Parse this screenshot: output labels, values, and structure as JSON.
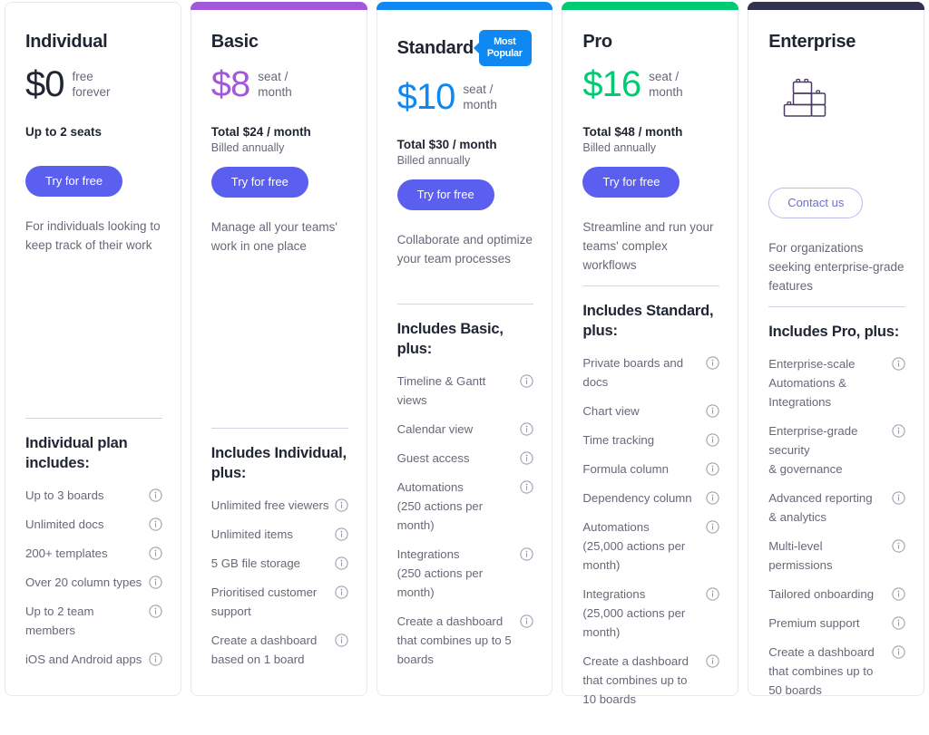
{
  "colors": {
    "individual_accent": "#1f2533",
    "basic_accent": "#a259d9",
    "standard_accent": "#0f88f2",
    "pro_accent": "#00ca72",
    "enterprise_accent": "#30324e",
    "cta_primary": "#5b5fef",
    "cta_outline_text": "#6b6fd4",
    "badge_bg": "#0f88f2",
    "body_text": "#676879",
    "heading_text": "#1f2533",
    "card_border": "#e6e9ef",
    "divider": "#d0d4e4"
  },
  "plans": [
    {
      "id": "individual",
      "name": "Individual",
      "top_bar_color": "",
      "has_top_bar": false,
      "price_amount": "$0",
      "price_unit": "free\nforever",
      "price_color": "#1f2533",
      "total_line": "",
      "billed_line": "",
      "seats_line": "Up to 2 seats",
      "cta_label": "Try for free",
      "cta_style": "primary",
      "tagline": "For individuals looking to keep track of their work",
      "features_title": "Individual plan includes:",
      "features": [
        "Up to 3 boards",
        "Unlimited docs",
        "200+ templates",
        "Over 20 column types",
        "Up to 2 team members",
        "iOS and Android apps"
      ]
    },
    {
      "id": "basic",
      "name": "Basic",
      "top_bar_color": "#a259d9",
      "has_top_bar": true,
      "price_amount": "$8",
      "price_unit": "seat /\nmonth",
      "price_color": "#a259d9",
      "total_line": "Total $24 / month",
      "billed_line": "Billed annually",
      "seats_line": "",
      "cta_label": "Try for free",
      "cta_style": "primary",
      "tagline": "Manage all your teams' work in one place",
      "features_title": "Includes Individual, plus:",
      "features": [
        "Unlimited free viewers",
        "Unlimited items",
        "5 GB file storage",
        "Prioritised customer support",
        "Create a dashboard based on 1 board"
      ]
    },
    {
      "id": "standard",
      "name": "Standard",
      "badge": "Most\nPopular",
      "top_bar_color": "#0f88f2",
      "has_top_bar": true,
      "price_amount": "$10",
      "price_unit": "seat /\nmonth",
      "price_color": "#0f88f2",
      "total_line": "Total $30 / month",
      "billed_line": "Billed annually",
      "seats_line": "",
      "cta_label": "Try for free",
      "cta_style": "primary",
      "tagline": "Collaborate and optimize your team processes",
      "features_title": "Includes Basic, plus:",
      "features": [
        "Timeline & Gantt views",
        "Calendar view",
        "Guest access",
        "Automations\n(250 actions per month)",
        "Integrations\n(250 actions per month)",
        "Create a dashboard that combines up to 5 boards"
      ]
    },
    {
      "id": "pro",
      "name": "Pro",
      "top_bar_color": "#00ca72",
      "has_top_bar": true,
      "price_amount": "$16",
      "price_unit": "seat /\nmonth",
      "price_color": "#00ca72",
      "total_line": "Total $48 / month",
      "billed_line": "Billed annually",
      "seats_line": "",
      "cta_label": "Try for free",
      "cta_style": "primary",
      "tagline": "Streamline and run your teams' complex workflows",
      "features_title": "Includes Standard, plus:",
      "features": [
        "Private boards and docs",
        "Chart view",
        "Time tracking",
        "Formula column",
        "Dependency column",
        "Automations\n(25,000 actions per month)",
        "Integrations\n(25,000 actions per month)",
        "Create a dashboard that combines up to 10 boards"
      ]
    },
    {
      "id": "enterprise",
      "name": "Enterprise",
      "top_bar_color": "#30324e",
      "has_top_bar": true,
      "price_amount": "",
      "price_unit": "",
      "price_color": "#30324e",
      "icon": "building-blocks-icon",
      "total_line": "",
      "billed_line": "",
      "seats_line": "",
      "cta_label": "Contact us",
      "cta_style": "outline",
      "tagline": "For organizations seeking enterprise-grade features",
      "features_title": "Includes Pro, plus:",
      "features": [
        "Enterprise-scale Automations & Integrations",
        "Enterprise-grade security\n& governance",
        "Advanced reporting\n& analytics",
        "Multi-level permissions",
        "Tailored onboarding",
        "Premium support",
        "Create a dashboard that combines up to 50 boards"
      ]
    }
  ]
}
